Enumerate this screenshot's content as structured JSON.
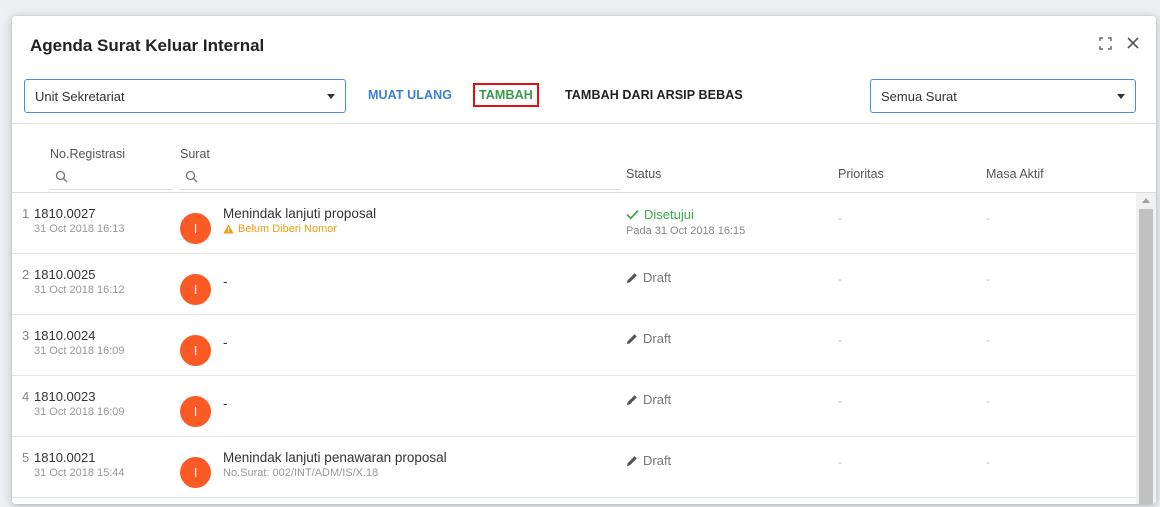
{
  "dialog": {
    "title": "Agenda Surat Keluar Internal",
    "icons": [
      "fullscreen-icon",
      "close-icon"
    ]
  },
  "toolbar": {
    "unit_select": "Unit Sekretariat",
    "muat_ulang": "MUAT ULANG",
    "tambah": "TAMBAH",
    "tambah_arsip": "TAMBAH DARI ARSIP BEBAS",
    "filter_select": "Semua Surat"
  },
  "table": {
    "headers": {
      "registrasi": "No.Registrasi",
      "surat": "Surat",
      "status": "Status",
      "prioritas": "Prioritas",
      "masa_aktif": "Masa Aktif"
    },
    "rows": [
      {
        "index": "1",
        "reg_no": "1810.0027",
        "reg_date": "31 Oct 2018 16:13",
        "avatar": "I",
        "subject": "Menindak lanjuti proposal",
        "sub_text": "Belum Diberi Nomor",
        "sub_type": "warning",
        "status": "Disetujui",
        "status_type": "approved",
        "status_sub": "Pada 31 Oct 2018 16:15",
        "prioritas": "-",
        "masa_aktif": "-"
      },
      {
        "index": "2",
        "reg_no": "1810.0025",
        "reg_date": "31 Oct 2018 16:12",
        "avatar": "I",
        "subject": "-",
        "sub_text": "",
        "sub_type": "",
        "status": "Draft",
        "status_type": "draft",
        "status_sub": "",
        "prioritas": "-",
        "masa_aktif": "-"
      },
      {
        "index": "3",
        "reg_no": "1810.0024",
        "reg_date": "31 Oct 2018 16:09",
        "avatar": "I",
        "subject": "-",
        "sub_text": "",
        "sub_type": "",
        "status": "Draft",
        "status_type": "draft",
        "status_sub": "",
        "prioritas": "-",
        "masa_aktif": "-"
      },
      {
        "index": "4",
        "reg_no": "1810.0023",
        "reg_date": "31 Oct 2018 16:09",
        "avatar": "I",
        "subject": "-",
        "sub_text": "",
        "sub_type": "",
        "status": "Draft",
        "status_type": "draft",
        "status_sub": "",
        "prioritas": "-",
        "masa_aktif": "-"
      },
      {
        "index": "5",
        "reg_no": "1810.0021",
        "reg_date": "31 Oct 2018 15:44",
        "avatar": "I",
        "subject": "Menindak lanjuti penawaran proposal",
        "sub_text": "No.Surat: 002/INT/ADM/IS/X.18",
        "sub_type": "muted",
        "status": "Draft",
        "status_type": "draft",
        "status_sub": "",
        "prioritas": "-",
        "masa_aktif": "-"
      }
    ]
  },
  "colors": {
    "accent": "#3b7ddd",
    "tambah": "#3a9a48",
    "highlight_border": "#e01010",
    "avatar": "#fb5a25",
    "approved": "#3cae4a",
    "warning": "#f39c12"
  }
}
